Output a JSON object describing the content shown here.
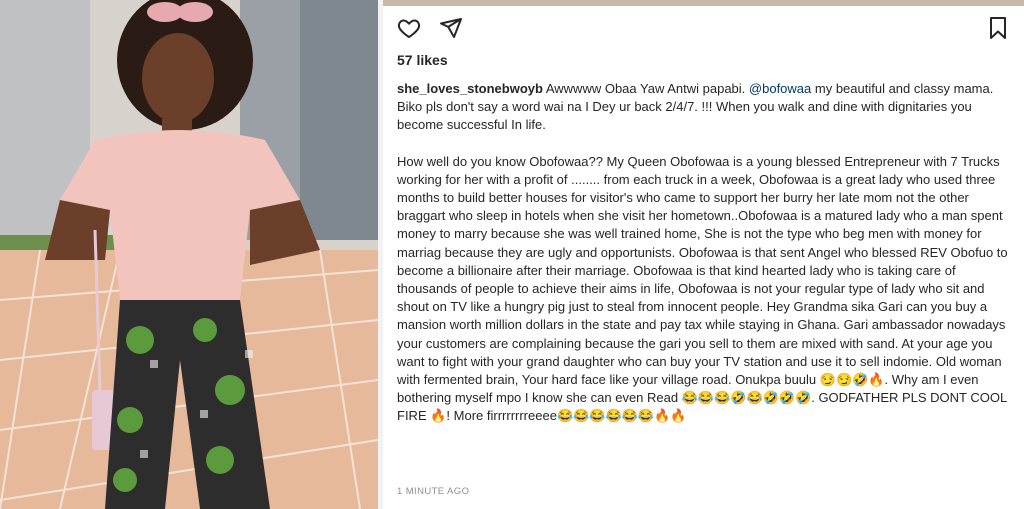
{
  "post": {
    "photo_alt": "Woman in pink off-shoulder blouse and floral trousers posing with hands on hips"
  },
  "actions": {
    "like_icon": "heart-icon",
    "share_icon": "send-icon",
    "save_icon": "bookmark-icon"
  },
  "likes": "57 likes",
  "caption": {
    "username": "she_loves_stonebwoyb",
    "para1_before": " Awwwww Obaa Yaw Antwi papabi. ",
    "mention": "@bofowaa",
    "para1_after": " my beautiful and classy mama. Biko pls don't say a word wai na I Dey ur back 2/4/7. !!! When you walk and dine with dignitaries you become successful In life.",
    "para2_main": "How well do you know Obofowaa?? My Queen Obofowaa is a young blessed Entrepreneur with 7 Trucks working for her with a profit of ........ from each truck in a week, Obofowaa is a great lady who used three months to build better houses for visitor's who came to support her burry her late mom not the other braggart who sleep in hotels when she visit her hometown..Obofowaa is a matured lady who a man spent money to marry because she was well trained home, She is not the type who beg men with money for marriag because they are ugly and opportunists. Obofowaa is that sent Angel who blessed REV Obofuo to become a billionaire after their marriage. Obofowaa is that kind hearted lady who is taking care of thousands of people to achieve their aims in life, Obofowaa is not your regular type of lady who sit and shout on TV like a hungry pig just to steal from innocent people. Hey Grandma sika Gari can you buy a mansion worth million dollars in the state and pay tax while staying in Ghana. Gari ambassador nowadays your customers are complaining because the gari you sell to them are mixed with sand. At your age you want to fight with your grand daughter who can buy your TV station and use it to sell indomie. Old woman with fermented brain, Your hard face like your village road. Onukpa buulu ",
    "emoji_run1": "😏😏🤣🔥",
    "para2_mid": ". Why am I even bothering myself mpo I know she can even Read ",
    "emoji_run2": "😂😂😂🤣😂🤣🤣🤣",
    "para2_shout": ". GODFATHER PLS DONT COOL FIRE ",
    "emoji_run3": "🔥",
    "para2_end": "! More firrrrrrrreeee",
    "emoji_run4": "😂😂😂😂😂😂🔥🔥"
  },
  "timestamp": "1 MINUTE AGO",
  "colors": {
    "text": "#262626",
    "mention": "#00376b",
    "muted": "#8e8e8e"
  }
}
